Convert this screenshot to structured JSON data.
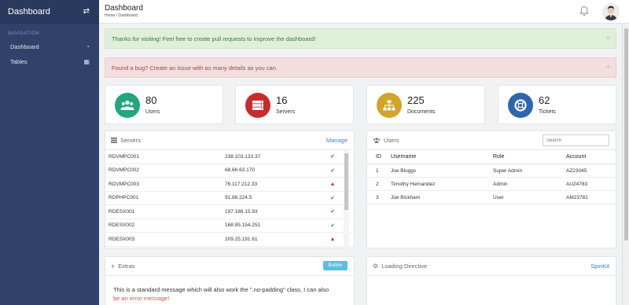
{
  "sidebar": {
    "title": "Dashboard",
    "toggle_icon": "swap-arrows-icon",
    "section": "NAVIGATION",
    "items": [
      {
        "label": "Dashboard",
        "icon": "speedometer-icon"
      },
      {
        "label": "Tables",
        "icon": "table-icon"
      }
    ]
  },
  "header": {
    "title": "Dashboard",
    "breadcrumb": "Home / Dashboard"
  },
  "alerts": {
    "success": "Thanks for visiting! Feel free to create pull requests to improve the dashboard!",
    "danger": "Found a bug? Create an issue with as many details as you can.",
    "close": "×"
  },
  "stats": [
    {
      "value": "80",
      "label": "Users",
      "color": "#21a67f",
      "icon": "users-icon"
    },
    {
      "value": "16",
      "label": "Servers",
      "color": "#c82b2e",
      "icon": "server-icon"
    },
    {
      "value": "225",
      "label": "Documents",
      "color": "#d3a42a",
      "icon": "sitemap-icon"
    },
    {
      "value": "62",
      "label": "Tickets",
      "color": "#2d66b0",
      "icon": "lifebuoy-icon"
    }
  ],
  "servers": {
    "title": "Servers",
    "action": "Manage",
    "rows": [
      {
        "name": "RDVMPC001",
        "ip": "238.103.133.37",
        "status": "ok"
      },
      {
        "name": "RDVMPC002",
        "ip": "68.66.63.170",
        "status": "ok"
      },
      {
        "name": "RDVMPC003",
        "ip": "76.117.212.33",
        "status": "warn"
      },
      {
        "name": "RDPHPC001",
        "ip": "91.88.224.5",
        "status": "ok"
      },
      {
        "name": "RDESX001",
        "ip": "197.188.15.93",
        "status": "ok"
      },
      {
        "name": "RDESX002",
        "ip": "168.85.154.251",
        "status": "ok"
      },
      {
        "name": "RDESX003",
        "ip": "209.25.191.61",
        "status": "warn"
      }
    ]
  },
  "users": {
    "title": "Users",
    "search_placeholder": "Search",
    "columns": [
      "ID",
      "Username",
      "Role",
      "Account"
    ],
    "rows": [
      {
        "id": "1",
        "username": "Joe Bloggs",
        "role": "Super Admin",
        "account": "AZ23045"
      },
      {
        "id": "2",
        "username": "Timothy Hernandez",
        "role": "Admin",
        "account": "AU24783"
      },
      {
        "id": "3",
        "username": "Joe Bickham",
        "role": "User",
        "account": "AM23781"
      }
    ]
  },
  "extras": {
    "title": "Extras",
    "button": "Button",
    "text": "This is a standard message which will also work the \".no-padding\" class, I can also",
    "error_text": "be an error message!"
  },
  "loading": {
    "title": "Loading Directive",
    "action": "SpinKit"
  }
}
